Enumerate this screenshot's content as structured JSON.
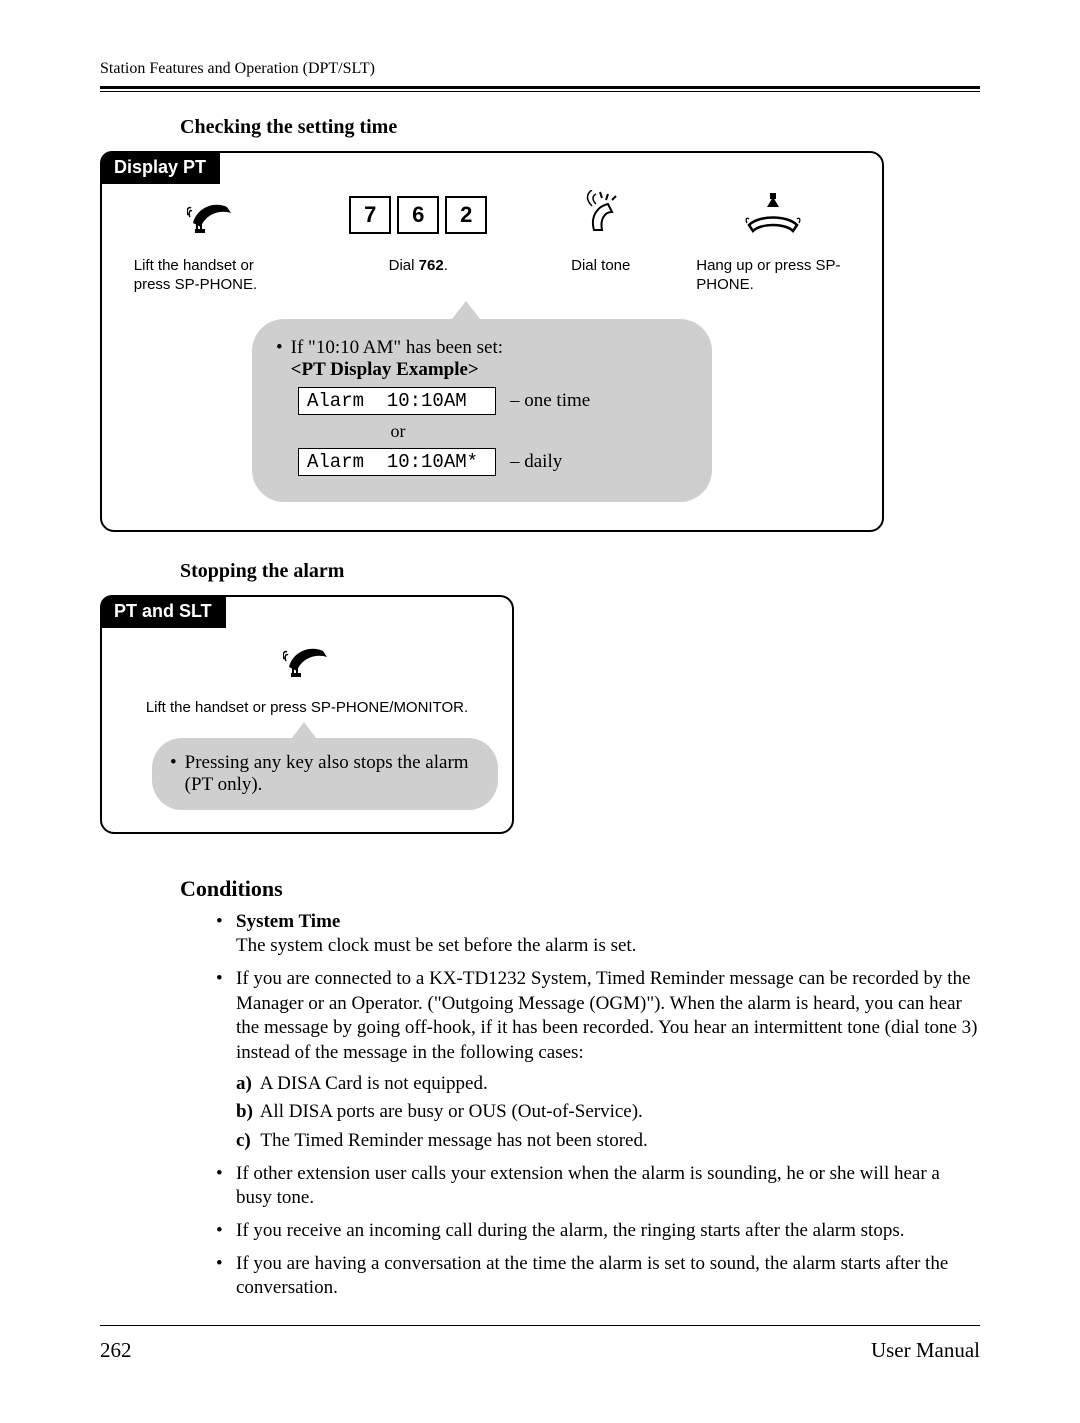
{
  "header": {
    "running_head": "Station Features and Operation (DPT/SLT)"
  },
  "checking": {
    "title": "Checking the setting time",
    "tab": "Display PT",
    "step1": {
      "caption": "Lift the handset or press SP-PHONE."
    },
    "step2": {
      "d1": "7",
      "d2": "6",
      "d3": "2",
      "caption_pre": "Dial ",
      "caption_bold": "762",
      "caption_post": "."
    },
    "step3": {
      "caption": "Dial tone"
    },
    "step4": {
      "caption": "Hang up or press SP-PHONE."
    },
    "callout": {
      "line1": "If \"10:10 AM\" has been set:",
      "line2": "<PT Display Example>",
      "disp1": "Alarm  10:10AM",
      "annot1": "– one time",
      "or": "or",
      "disp2": "Alarm  10:10AM*",
      "annot2": "– daily"
    }
  },
  "stopping": {
    "title": "Stopping the alarm",
    "tab": "PT and SLT",
    "caption": "Lift the handset or press SP-PHONE/MONITOR.",
    "note": "Pressing any key also stops the alarm (PT only)."
  },
  "conditions": {
    "heading": "Conditions",
    "items": {
      "c1_title": "System Time",
      "c1_body": "The system clock must be set before the alarm is set.",
      "c2": "If you are connected to a KX-TD1232 System, Timed Reminder message can be recorded by the Manager or an Operator. (\"Outgoing Message (OGM)\"). When the alarm is heard, you can hear the message by going off-hook, if it has been recorded. You hear an intermittent tone (dial tone 3) instead of the message in the following cases:",
      "c2a": "A DISA Card is not equipped.",
      "c2b": "All DISA ports are busy or OUS (Out-of-Service).",
      "c2c": "The Timed Reminder message has not been stored.",
      "c3": "If other extension user calls your extension when the alarm is sounding, he or she will hear a busy tone.",
      "c4": "If you receive an incoming call during the alarm, the ringing starts after the alarm stops.",
      "c5": "If you are having a conversation at the time the alarm is set to sound, the alarm starts after the conversation."
    }
  },
  "footer": {
    "page": "262",
    "label": "User Manual"
  }
}
